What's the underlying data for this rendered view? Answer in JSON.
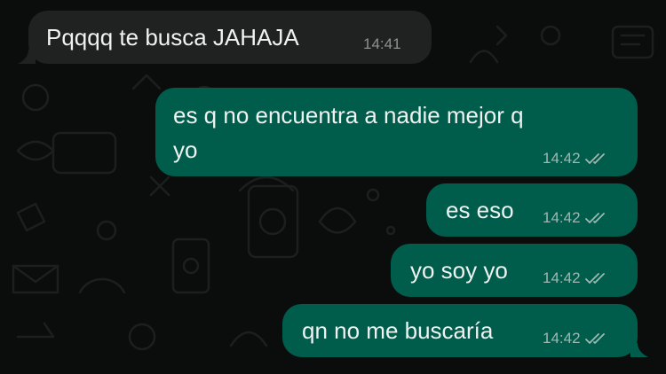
{
  "chat": {
    "messages": [
      {
        "direction": "incoming",
        "text": "Pqqqq te busca JAHAJA",
        "time": "14:41"
      },
      {
        "direction": "outgoing",
        "text_line1": "es q no encuentra a nadie mejor q",
        "text_line2": "yo",
        "time": "14:42",
        "status": "read-double-check-icon"
      },
      {
        "direction": "outgoing",
        "text": "es eso",
        "time": "14:42",
        "status": "read-double-check-icon"
      },
      {
        "direction": "outgoing",
        "text": "yo soy yo",
        "time": "14:42",
        "status": "read-double-check-icon"
      },
      {
        "direction": "outgoing",
        "text": "qn no me buscaría",
        "time": "14:42",
        "status": "read-double-check-icon"
      }
    ]
  },
  "colors": {
    "background": "#0b0d0c",
    "incoming_bubble": "#1f2220",
    "outgoing_bubble": "#005c4b",
    "text": "#eef2f0"
  }
}
